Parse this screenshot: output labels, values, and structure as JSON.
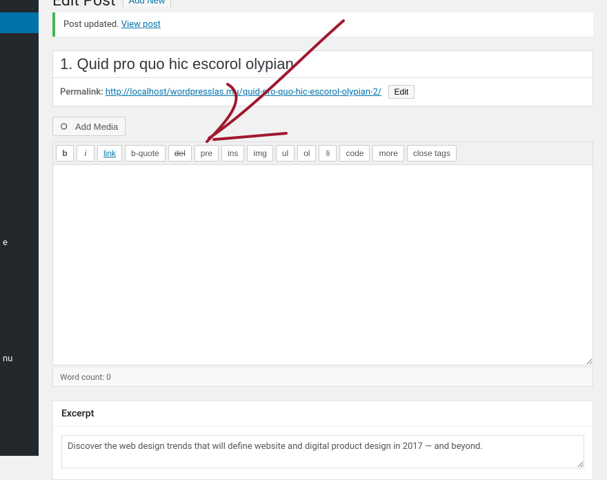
{
  "sidebar": {
    "item_label_partial_1": "e",
    "item_label_partial_2": "nu"
  },
  "header": {
    "page_title": "Edit Post",
    "add_new_label": "Add New"
  },
  "notice": {
    "updated_text": "Post updated.",
    "view_link": "View post"
  },
  "post": {
    "title": "1. Quid pro quo hic escorol olypian",
    "permalink_label": "Permalink:",
    "permalink_base": "http://localhost/wordpresslas.mu/",
    "permalink_slug": "quid-pro-quo-hic-escorol-olypian-2/",
    "edit_label": "Edit"
  },
  "editor": {
    "add_media_label": "Add Media",
    "quicktags": {
      "b": "b",
      "i": "i",
      "link": "link",
      "bquote": "b-quote",
      "del": "del",
      "pre": "pre",
      "ins": "ins",
      "img": "img",
      "ul": "ul",
      "ol": "ol",
      "li": "li",
      "code": "code",
      "more": "more",
      "close": "close tags"
    },
    "word_count_label": "Word count: 0"
  },
  "excerpt": {
    "heading": "Excerpt",
    "text": "Discover the web design trends that will define website and digital product design in 2017 — and beyond."
  },
  "colors": {
    "accent": "#0073aa",
    "success": "#46b450",
    "sidebar_bg": "#23282d",
    "annotation": "#a01830"
  }
}
